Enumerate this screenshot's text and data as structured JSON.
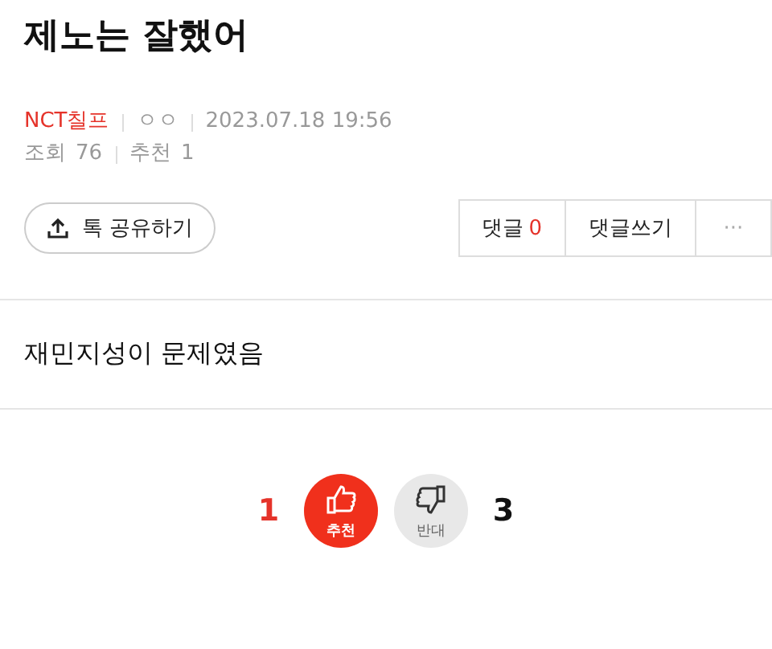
{
  "post": {
    "title": "제노는 잘했어",
    "author": "NCT칠프",
    "author_tag": "ㅇㅇ",
    "date": "2023.07.18 19:56",
    "views_label": "조회",
    "views": "76",
    "recommend_label": "추천",
    "recommend": "1"
  },
  "share_button": "톡 공유하기",
  "comment_buttons": {
    "comments_label": "댓글",
    "comments_count": "0",
    "write": "댓글쓰기",
    "more": "···"
  },
  "body": "재민지성이 문제였음",
  "votes": {
    "up_count": "1",
    "up_label": "추천",
    "down_label": "반대",
    "down_count": "3"
  }
}
